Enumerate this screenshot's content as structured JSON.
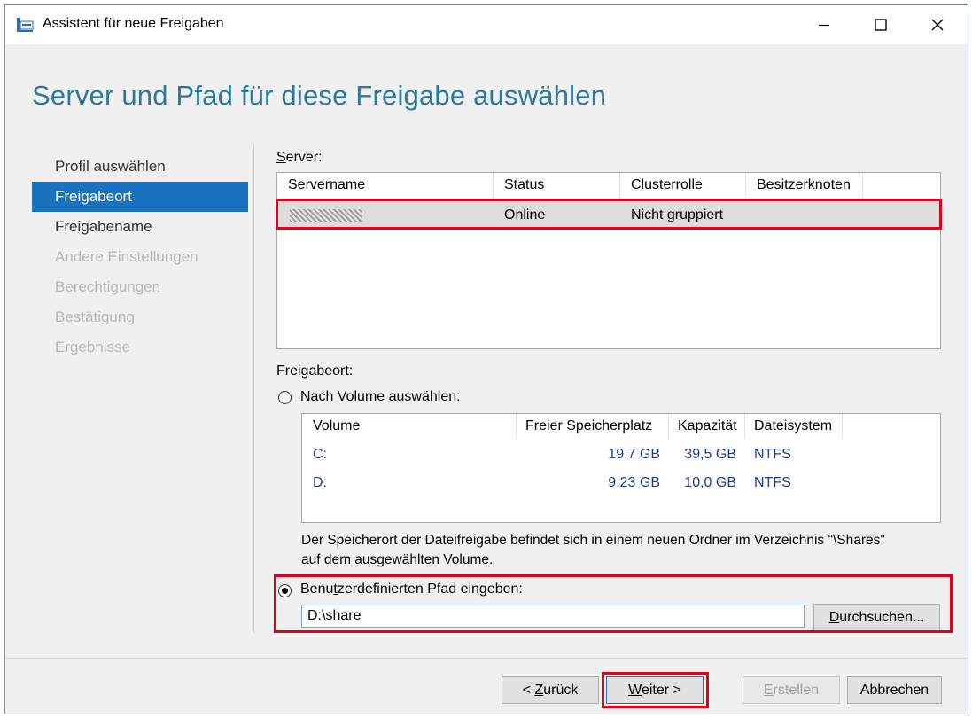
{
  "window": {
    "title": "Assistent für neue Freigaben",
    "minimize_icon": "minimize-icon",
    "maximize_icon": "maximize-icon",
    "close_icon": "close-icon"
  },
  "page_title": "Server und Pfad für diese Freigabe auswählen",
  "nav": {
    "items": [
      {
        "label": "Profil auswählen",
        "state": "normal"
      },
      {
        "label": "Freigabeort",
        "state": "selected"
      },
      {
        "label": "Freigabename",
        "state": "normal"
      },
      {
        "label": "Andere Einstellungen",
        "state": "disabled"
      },
      {
        "label": "Berechtigungen",
        "state": "disabled"
      },
      {
        "label": "Bestätigung",
        "state": "disabled"
      },
      {
        "label": "Ergebnisse",
        "state": "disabled"
      }
    ]
  },
  "server": {
    "label_accel": "S",
    "label_rest": "erver:",
    "columns": [
      "Servername",
      "Status",
      "Clusterrolle",
      "Besitzerknoten"
    ],
    "rows": [
      {
        "servername": "",
        "status": "Online",
        "clusterrolle": "Nicht gruppiert",
        "besitzerknoten": ""
      }
    ]
  },
  "location": {
    "label": "Freigabeort:",
    "by_volume": {
      "pre": "Nach ",
      "accel": "V",
      "post": "olume auswählen:",
      "selected": false
    },
    "volume_columns": [
      "Volume",
      "Freier Speicherplatz",
      "Kapazität",
      "Dateisystem"
    ],
    "volumes": [
      {
        "volume": "C:",
        "free": "19,7 GB",
        "capacity": "39,5 GB",
        "fs": "NTFS"
      },
      {
        "volume": "D:",
        "free": "9,23 GB",
        "capacity": "10,0 GB",
        "fs": "NTFS"
      }
    ],
    "description_line1": "Der Speicherort der Dateifreigabe befindet sich in einem neuen Ordner im Verzeichnis \"\\Shares\"",
    "description_line2": "auf dem ausgewählten Volume.",
    "custom_path": {
      "pre": "Benu",
      "accel": "t",
      "post": "zerdefinierten Pfad eingeben:",
      "selected": true,
      "value": "D:\\share",
      "browse_accel": "D",
      "browse_rest": "urchsuchen..."
    }
  },
  "footer": {
    "back_pre": "< ",
    "back_accel": "Z",
    "back_post": "urück",
    "next_accel": "W",
    "next_post": "eiter >",
    "create_accel": "E",
    "create_post": "rstellen",
    "cancel": "Abbrechen"
  },
  "highlight_color": "#e0001a",
  "accent_color": "#1a73c0",
  "title_color": "#2b7a9e"
}
